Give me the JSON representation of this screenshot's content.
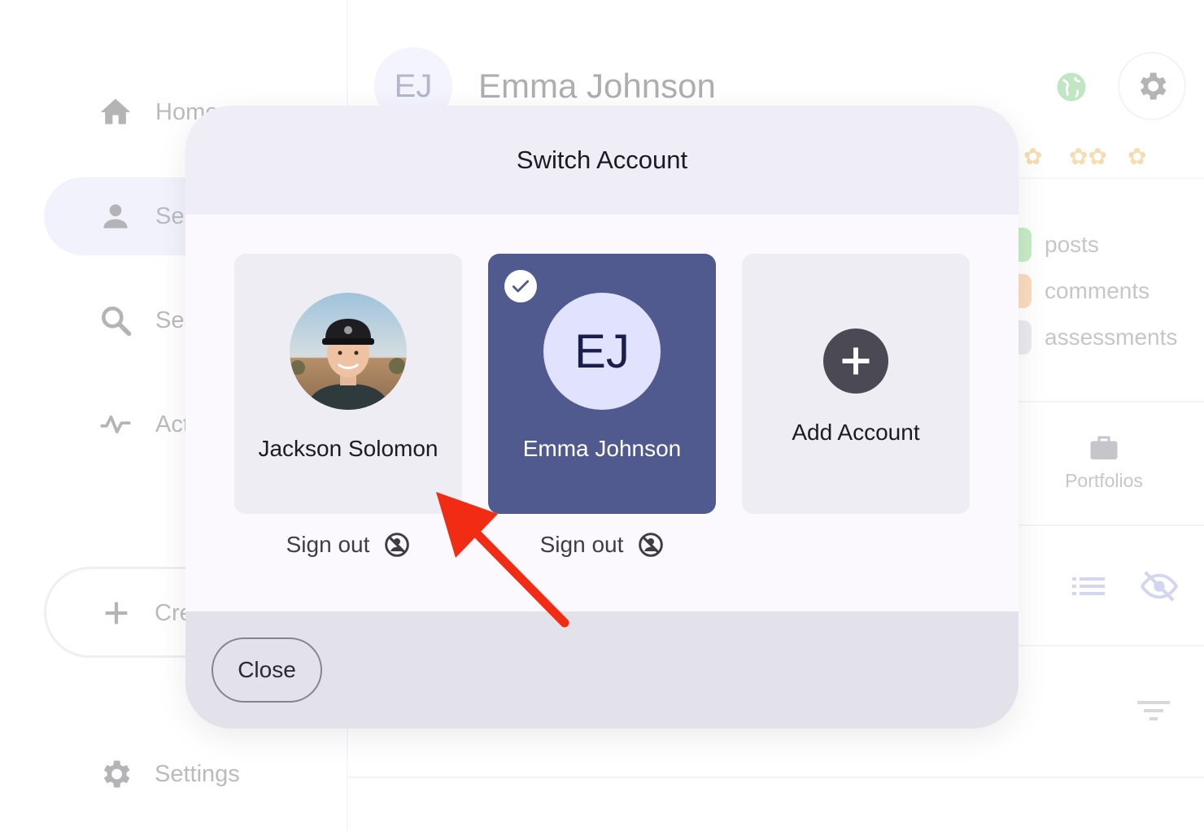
{
  "sidebar": {
    "items": [
      {
        "label": "Home",
        "icon": "home-icon"
      },
      {
        "label": "Self",
        "icon": "person-icon"
      },
      {
        "label": "Search",
        "icon": "search-icon"
      },
      {
        "label": "Activity",
        "icon": "activity-icon"
      }
    ],
    "create_label": "Create",
    "settings_label": "Settings"
  },
  "header": {
    "avatar_initials": "EJ",
    "user_name": "Emma Johnson"
  },
  "profile_stats": [
    {
      "label": "posts",
      "color": "#6bcf6b"
    },
    {
      "label": "comments",
      "color": "#f2a65a"
    },
    {
      "label": "assessments",
      "color": "#c9c9d2"
    }
  ],
  "portfolios_label": "Portfolios",
  "modal": {
    "title": "Switch Account",
    "accounts": [
      {
        "name": "Jackson Solomon",
        "avatar": "photo",
        "selected": false,
        "sign_out_label": "Sign out"
      },
      {
        "name": "Emma Johnson",
        "initials": "EJ",
        "selected": true,
        "sign_out_label": "Sign out"
      }
    ],
    "add_account_label": "Add Account",
    "close_label": "Close"
  },
  "colors": {
    "selected_card": "#505a8f",
    "annotation_arrow": "#f22c14"
  }
}
